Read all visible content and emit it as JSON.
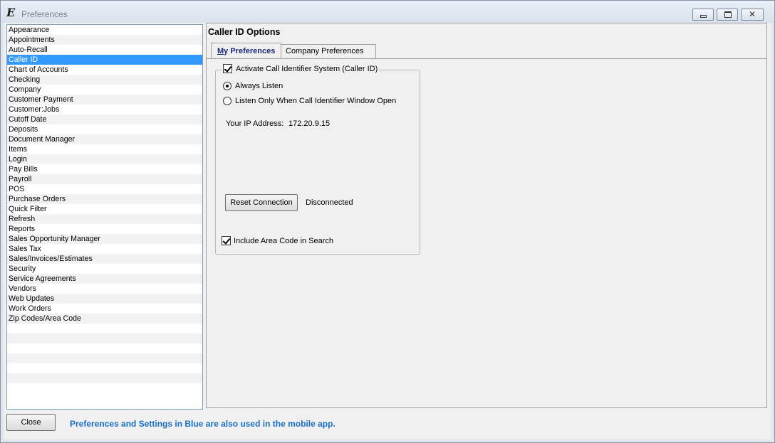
{
  "window": {
    "title": "Preferences",
    "app_icon": "E"
  },
  "window_controls": {
    "minimize_icon": "minimize-icon",
    "maximize_icon": "maximize-icon",
    "close_glyph": "✕"
  },
  "sidebar": {
    "selected": "Caller ID",
    "items": [
      "Appearance",
      "Appointments",
      "Auto-Recall",
      "Caller ID",
      "Chart of Accounts",
      "Checking",
      "Company",
      "Customer Payment",
      "Customer:Jobs",
      "Cutoff Date",
      "Deposits",
      "Document Manager",
      "Items",
      "Login",
      "Pay Bills",
      "Payroll",
      "POS",
      "Purchase Orders",
      "Quick Filter",
      "Refresh",
      "Reports",
      "Sales Opportunity Manager",
      "Sales Tax",
      "Sales/Invoices/Estimates",
      "Security",
      "Service Agreements",
      "Vendors",
      "Web Updates",
      "Work Orders",
      "Zip Codes/Area Code"
    ]
  },
  "panel": {
    "header": "Caller ID Options",
    "tabs": [
      {
        "label": "My Preferences",
        "active": true
      },
      {
        "label": "Company Preferences",
        "active": false
      }
    ],
    "group": {
      "checkbox_label": "Activate Call Identifier System (Caller ID)",
      "checkbox_checked": true,
      "radio_always": "Always Listen",
      "radio_window": "Listen Only When Call Identifier Window Open",
      "radio_selected": "always",
      "ip_label": "Your IP Address:",
      "ip_value": "172.20.9.15",
      "reset_button": "Reset Connection",
      "connection_status": "Disconnected",
      "area_code_label": "Include Area Code in Search",
      "area_code_checked": true
    }
  },
  "footer": {
    "close_button": "Close",
    "note": "Preferences and Settings in Blue are also used in the mobile app.",
    "note_color": "#1a6fc4"
  },
  "colors": {
    "selection": "#3399ff",
    "tab_active_text": "#1a2a7a"
  }
}
